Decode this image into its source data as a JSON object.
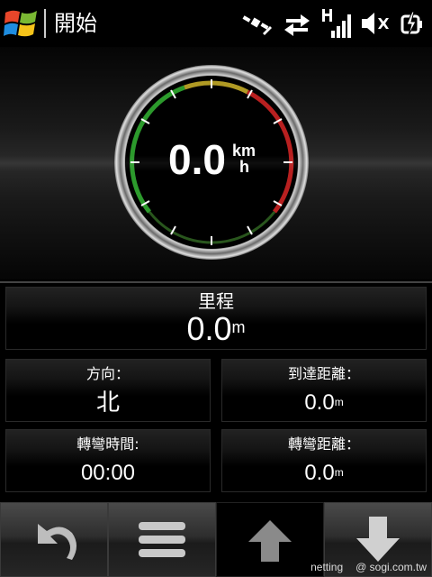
{
  "status_bar": {
    "start_label": "開始",
    "icons": [
      "start-logo-icon",
      "gps-satellite-icon",
      "data-transfer-icon",
      "signal-strength-icon",
      "speaker-muted-icon",
      "battery-charging-icon"
    ]
  },
  "speedometer": {
    "speed": "0.0",
    "unit_top": "km",
    "unit_bottom": "h"
  },
  "trip": {
    "label": "里程",
    "value": "0.0",
    "unit": "m"
  },
  "direction": {
    "label": "方向：",
    "value": "北"
  },
  "distance_to_destination": {
    "label": "到達距離：",
    "value": "0.0",
    "unit": "m"
  },
  "turn_time": {
    "label": "轉彎時間:",
    "value_hours": "00",
    "value_sep": ":",
    "value_minutes": "00"
  },
  "turn_distance": {
    "label": "轉彎距離：",
    "value": "0.0",
    "unit": "m"
  },
  "toolbar": {
    "icons": [
      "back-arrow-icon",
      "menu-icon",
      "up-arrow-icon",
      "down-arrow-icon"
    ]
  },
  "watermark": {
    "left": "netting",
    "right": "@ sogi.com.tw"
  }
}
